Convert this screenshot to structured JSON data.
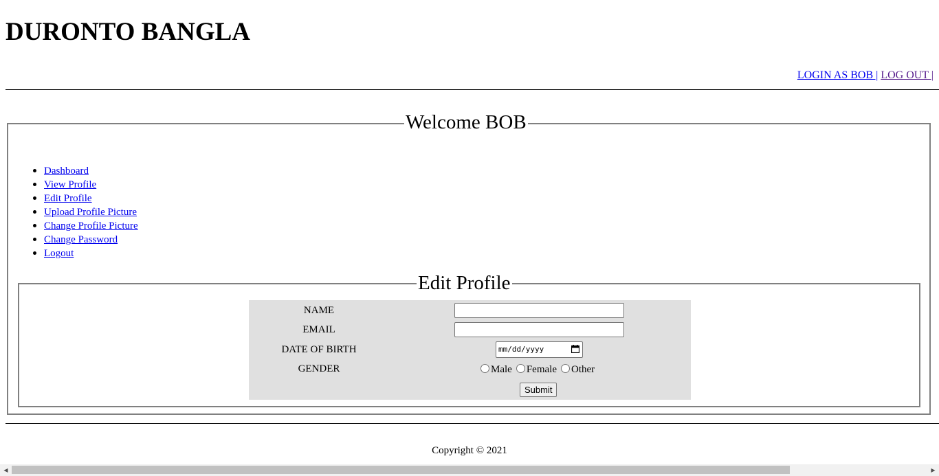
{
  "site": {
    "title": "DURONTO BANGLA"
  },
  "header_links": {
    "login": "LOGIN AS BOB |",
    "logout": "LOG OUT |"
  },
  "welcome": {
    "legend": "Welcome BOB"
  },
  "nav": {
    "items": [
      {
        "label": "Dashboard"
      },
      {
        "label": "View Profile"
      },
      {
        "label": "Edit Profile"
      },
      {
        "label": "Upload Profile Picture"
      },
      {
        "label": "Change Profile Picture"
      },
      {
        "label": "Change Password"
      },
      {
        "label": "Logout"
      }
    ]
  },
  "edit_profile": {
    "legend": "Edit Profile",
    "name_label": "NAME",
    "name_value": "",
    "email_label": "EMAIL",
    "email_value": "",
    "dob_label": "DATE OF BIRTH",
    "dob_placeholder": "mm/dd/yyyy",
    "gender_label": "GENDER",
    "gender_options": [
      "Male",
      "Female",
      "Other"
    ],
    "submit_label": "Submit"
  },
  "footer": {
    "copyright": "Copyright © 2021"
  },
  "colors": {
    "link": "#0000ee",
    "visited_link": "#551a8b",
    "form_background": "#e0e0e0"
  }
}
